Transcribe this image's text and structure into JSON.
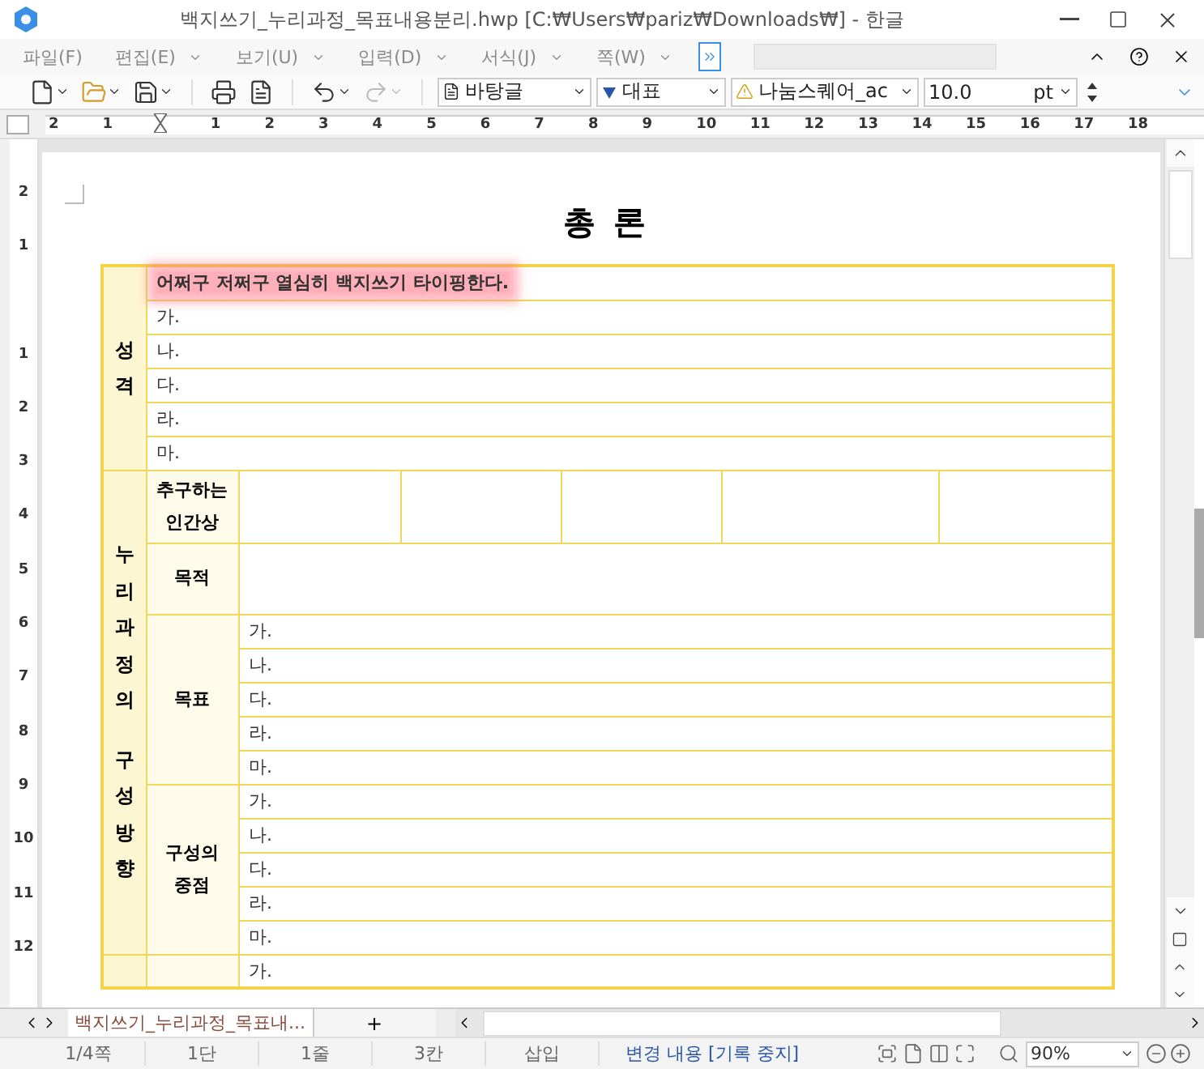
{
  "window": {
    "title": "백지쓰기_누리과정_목표내용분리.hwp [C:₩Users₩pariz₩Downloads₩] - 한글"
  },
  "menu": [
    {
      "label": "파일(F)",
      "has_dropdown": false
    },
    {
      "label": "편집(E)",
      "has_dropdown": true
    },
    {
      "label": "보기(U)",
      "has_dropdown": true
    },
    {
      "label": "입력(D)",
      "has_dropdown": true
    },
    {
      "label": "서식(J)",
      "has_dropdown": true
    },
    {
      "label": "쪽(W)",
      "has_dropdown": true
    }
  ],
  "toolbar": {
    "style": "바탕글",
    "para_style": "대표",
    "font": "나눔스퀘어_ac",
    "size": "10.0",
    "unit": "pt"
  },
  "ruler": {
    "left_labels": [
      "2",
      "1"
    ],
    "right_labels": [
      "1",
      "2",
      "3",
      "4",
      "5",
      "6",
      "7",
      "8",
      "9",
      "10",
      "11",
      "12",
      "13",
      "14",
      "15",
      "16",
      "17",
      "18"
    ]
  },
  "vruler": {
    "top_labels": [
      "2",
      "1"
    ],
    "labels": [
      "1",
      "2",
      "3",
      "4",
      "5",
      "6",
      "7",
      "8",
      "9",
      "10",
      "11",
      "12"
    ]
  },
  "document": {
    "heading": "총 론",
    "sections": [
      {
        "label_lines": [
          "성격"
        ],
        "lines": [
          {
            "text": "어쩌구 저쩌구 열심히 백지쓰기 타이핑한다.",
            "highlighted": true
          },
          {
            "text": "가.",
            "highlighted": false
          },
          {
            "text": "나.",
            "highlighted": false
          },
          {
            "text": "다.",
            "highlighted": false
          },
          {
            "text": "라.",
            "highlighted": false
          },
          {
            "text": "마.",
            "highlighted": false
          }
        ]
      },
      {
        "label_lines": [
          "누리과정의",
          "구성방향"
        ],
        "groups": [
          {
            "kind": "grid",
            "label_lines": [
              "추구하는",
              "인간상"
            ]
          },
          {
            "kind": "blank",
            "label_lines": [
              "목적"
            ]
          },
          {
            "kind": "lines",
            "label_lines": [
              "목표"
            ],
            "lines": [
              "가.",
              "나.",
              "다.",
              "라.",
              "마."
            ]
          },
          {
            "kind": "lines",
            "label_lines": [
              "구성의",
              "중점"
            ],
            "lines": [
              "가.",
              "나.",
              "다.",
              "라.",
              "마."
            ]
          }
        ]
      },
      {
        "groups": [
          {
            "kind": "lines",
            "lines": [
              "가."
            ]
          }
        ]
      }
    ]
  },
  "tabs": [
    {
      "label": "백지쓰기_누리과정_목표내...",
      "selected": true
    }
  ],
  "new_tab": "+",
  "status_bar": {
    "items": [
      "1/4쪽",
      "1단",
      "1줄",
      "3칸",
      "삽입"
    ],
    "track_changes": "변경 내용 [기록 중지]",
    "zoom": "90%"
  }
}
